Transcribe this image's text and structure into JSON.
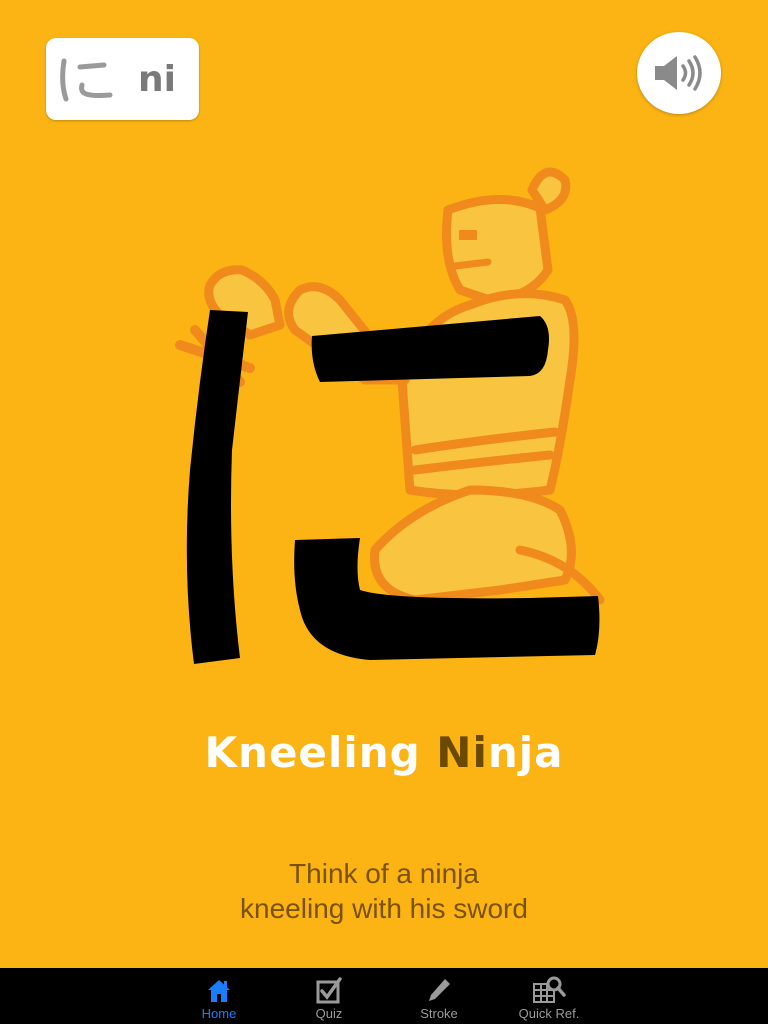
{
  "kana": {
    "character": "に",
    "romaji": "ni"
  },
  "sound_button": {
    "icon": "speaker-icon"
  },
  "mnemonic": {
    "title_before": "Kneeling ",
    "title_highlight": "Ni",
    "title_after": "nja",
    "description_line1": "Think of a ninja",
    "description_line2": "kneeling with his sword"
  },
  "tabbar": {
    "active_color": "#1a7cff",
    "items": [
      {
        "label": "Home",
        "icon": "home-icon",
        "active": true
      },
      {
        "label": "Quiz",
        "icon": "checkbox-icon",
        "active": false
      },
      {
        "label": "Stroke",
        "icon": "pencil-icon",
        "active": false
      },
      {
        "label": "Quick Ref.",
        "icon": "grid-search-icon",
        "active": false
      }
    ]
  },
  "colors": {
    "background": "#fbb414",
    "ninja_outline": "#f08a1c",
    "ninja_fill": "#f9c540"
  }
}
